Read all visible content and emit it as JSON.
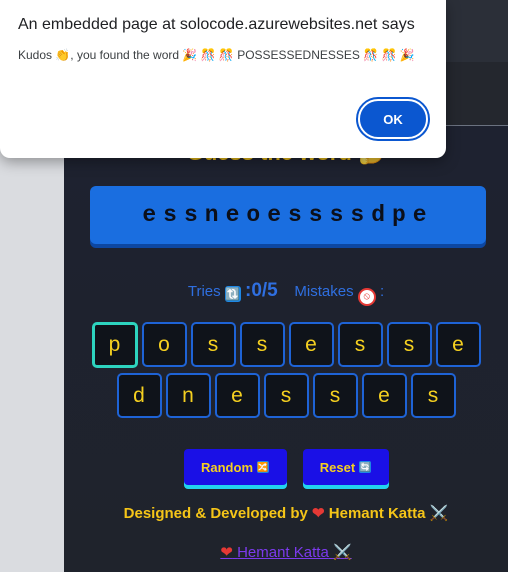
{
  "dialog": {
    "title": "An embedded page at solocode.azurewebsites.net says",
    "message": "Kudos 👏, you found the word 🎉 🎊 🎊 POSSESSEDNESSES 🎊 🎊 🎉",
    "ok_label": "OK"
  },
  "game": {
    "title": "Guess the word 🤔",
    "scrambled": "essneoessssdpe",
    "tries_label": "Tries",
    "tries_icon": "🔃",
    "tries_value": "0/5",
    "mistakes_label": "Mistakes",
    "mistakes_suffix": ":",
    "letters_row1": [
      "p",
      "o",
      "s",
      "s",
      "e",
      "s",
      "s",
      "e"
    ],
    "letters_row2": [
      "d",
      "n",
      "e",
      "s",
      "s",
      "e",
      "s"
    ],
    "random_label": "Random",
    "random_icon": "🔀",
    "reset_label": "Reset",
    "reset_icon": "🔄",
    "credit": "Designed & Developed by",
    "author": "Hemant Katta",
    "author_icon": "⚔️",
    "footer_link": "Hemant Katta"
  },
  "colors": {
    "accent": "#1a6ee0",
    "tile_border": "#1e63d6",
    "tile_text": "#f5d020",
    "active_tile": "#2dd4bf",
    "button": "#1a10e6",
    "dialog_button": "#0b57d0"
  }
}
